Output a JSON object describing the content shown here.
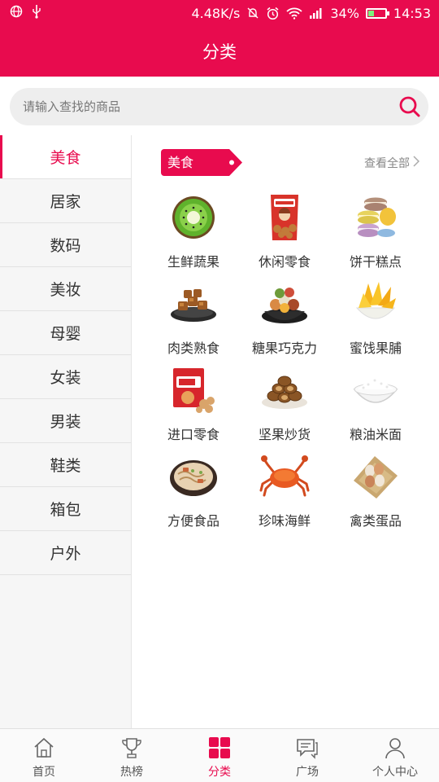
{
  "status_bar": {
    "speed": "4.48K/s",
    "battery": "34%",
    "battery_level": 0.34,
    "time": "14:53"
  },
  "header": {
    "title": "分类"
  },
  "search": {
    "placeholder": "请输入查找的商品"
  },
  "sidebar": {
    "items": [
      {
        "label": "美食",
        "active": true
      },
      {
        "label": "居家"
      },
      {
        "label": "数码"
      },
      {
        "label": "美妆"
      },
      {
        "label": "母婴"
      },
      {
        "label": "女装"
      },
      {
        "label": "男装"
      },
      {
        "label": "鞋类"
      },
      {
        "label": "箱包"
      },
      {
        "label": "户外"
      }
    ]
  },
  "section": {
    "tag": "美食",
    "view_all": "查看全部"
  },
  "products": [
    {
      "label": "生鲜蔬果",
      "icon": "kiwi-icon"
    },
    {
      "label": "休闲零食",
      "icon": "snack-bag-icon"
    },
    {
      "label": "饼干糕点",
      "icon": "macaron-icon"
    },
    {
      "label": "肉类熟食",
      "icon": "meat-bowl-icon"
    },
    {
      "label": "糖果巧克力",
      "icon": "candy-bowl-icon"
    },
    {
      "label": "蜜饯果脯",
      "icon": "dried-mango-icon"
    },
    {
      "label": "进口零食",
      "icon": "cereal-box-icon"
    },
    {
      "label": "坚果炒货",
      "icon": "nuts-plate-icon"
    },
    {
      "label": "粮油米面",
      "icon": "rice-bowl-icon"
    },
    {
      "label": "方便食品",
      "icon": "noodle-bowl-icon"
    },
    {
      "label": "珍味海鲜",
      "icon": "crab-icon"
    },
    {
      "label": "禽类蛋品",
      "icon": "eggs-icon"
    }
  ],
  "bottom_nav": [
    {
      "label": "首页",
      "icon": "home-icon"
    },
    {
      "label": "热榜",
      "icon": "trophy-icon"
    },
    {
      "label": "分类",
      "icon": "grid-icon",
      "active": true
    },
    {
      "label": "广场",
      "icon": "chat-icon"
    },
    {
      "label": "个人中心",
      "icon": "person-icon"
    }
  ],
  "colors": {
    "accent": "#e80b4e",
    "sidebar_bg": "#f6f6f6"
  }
}
